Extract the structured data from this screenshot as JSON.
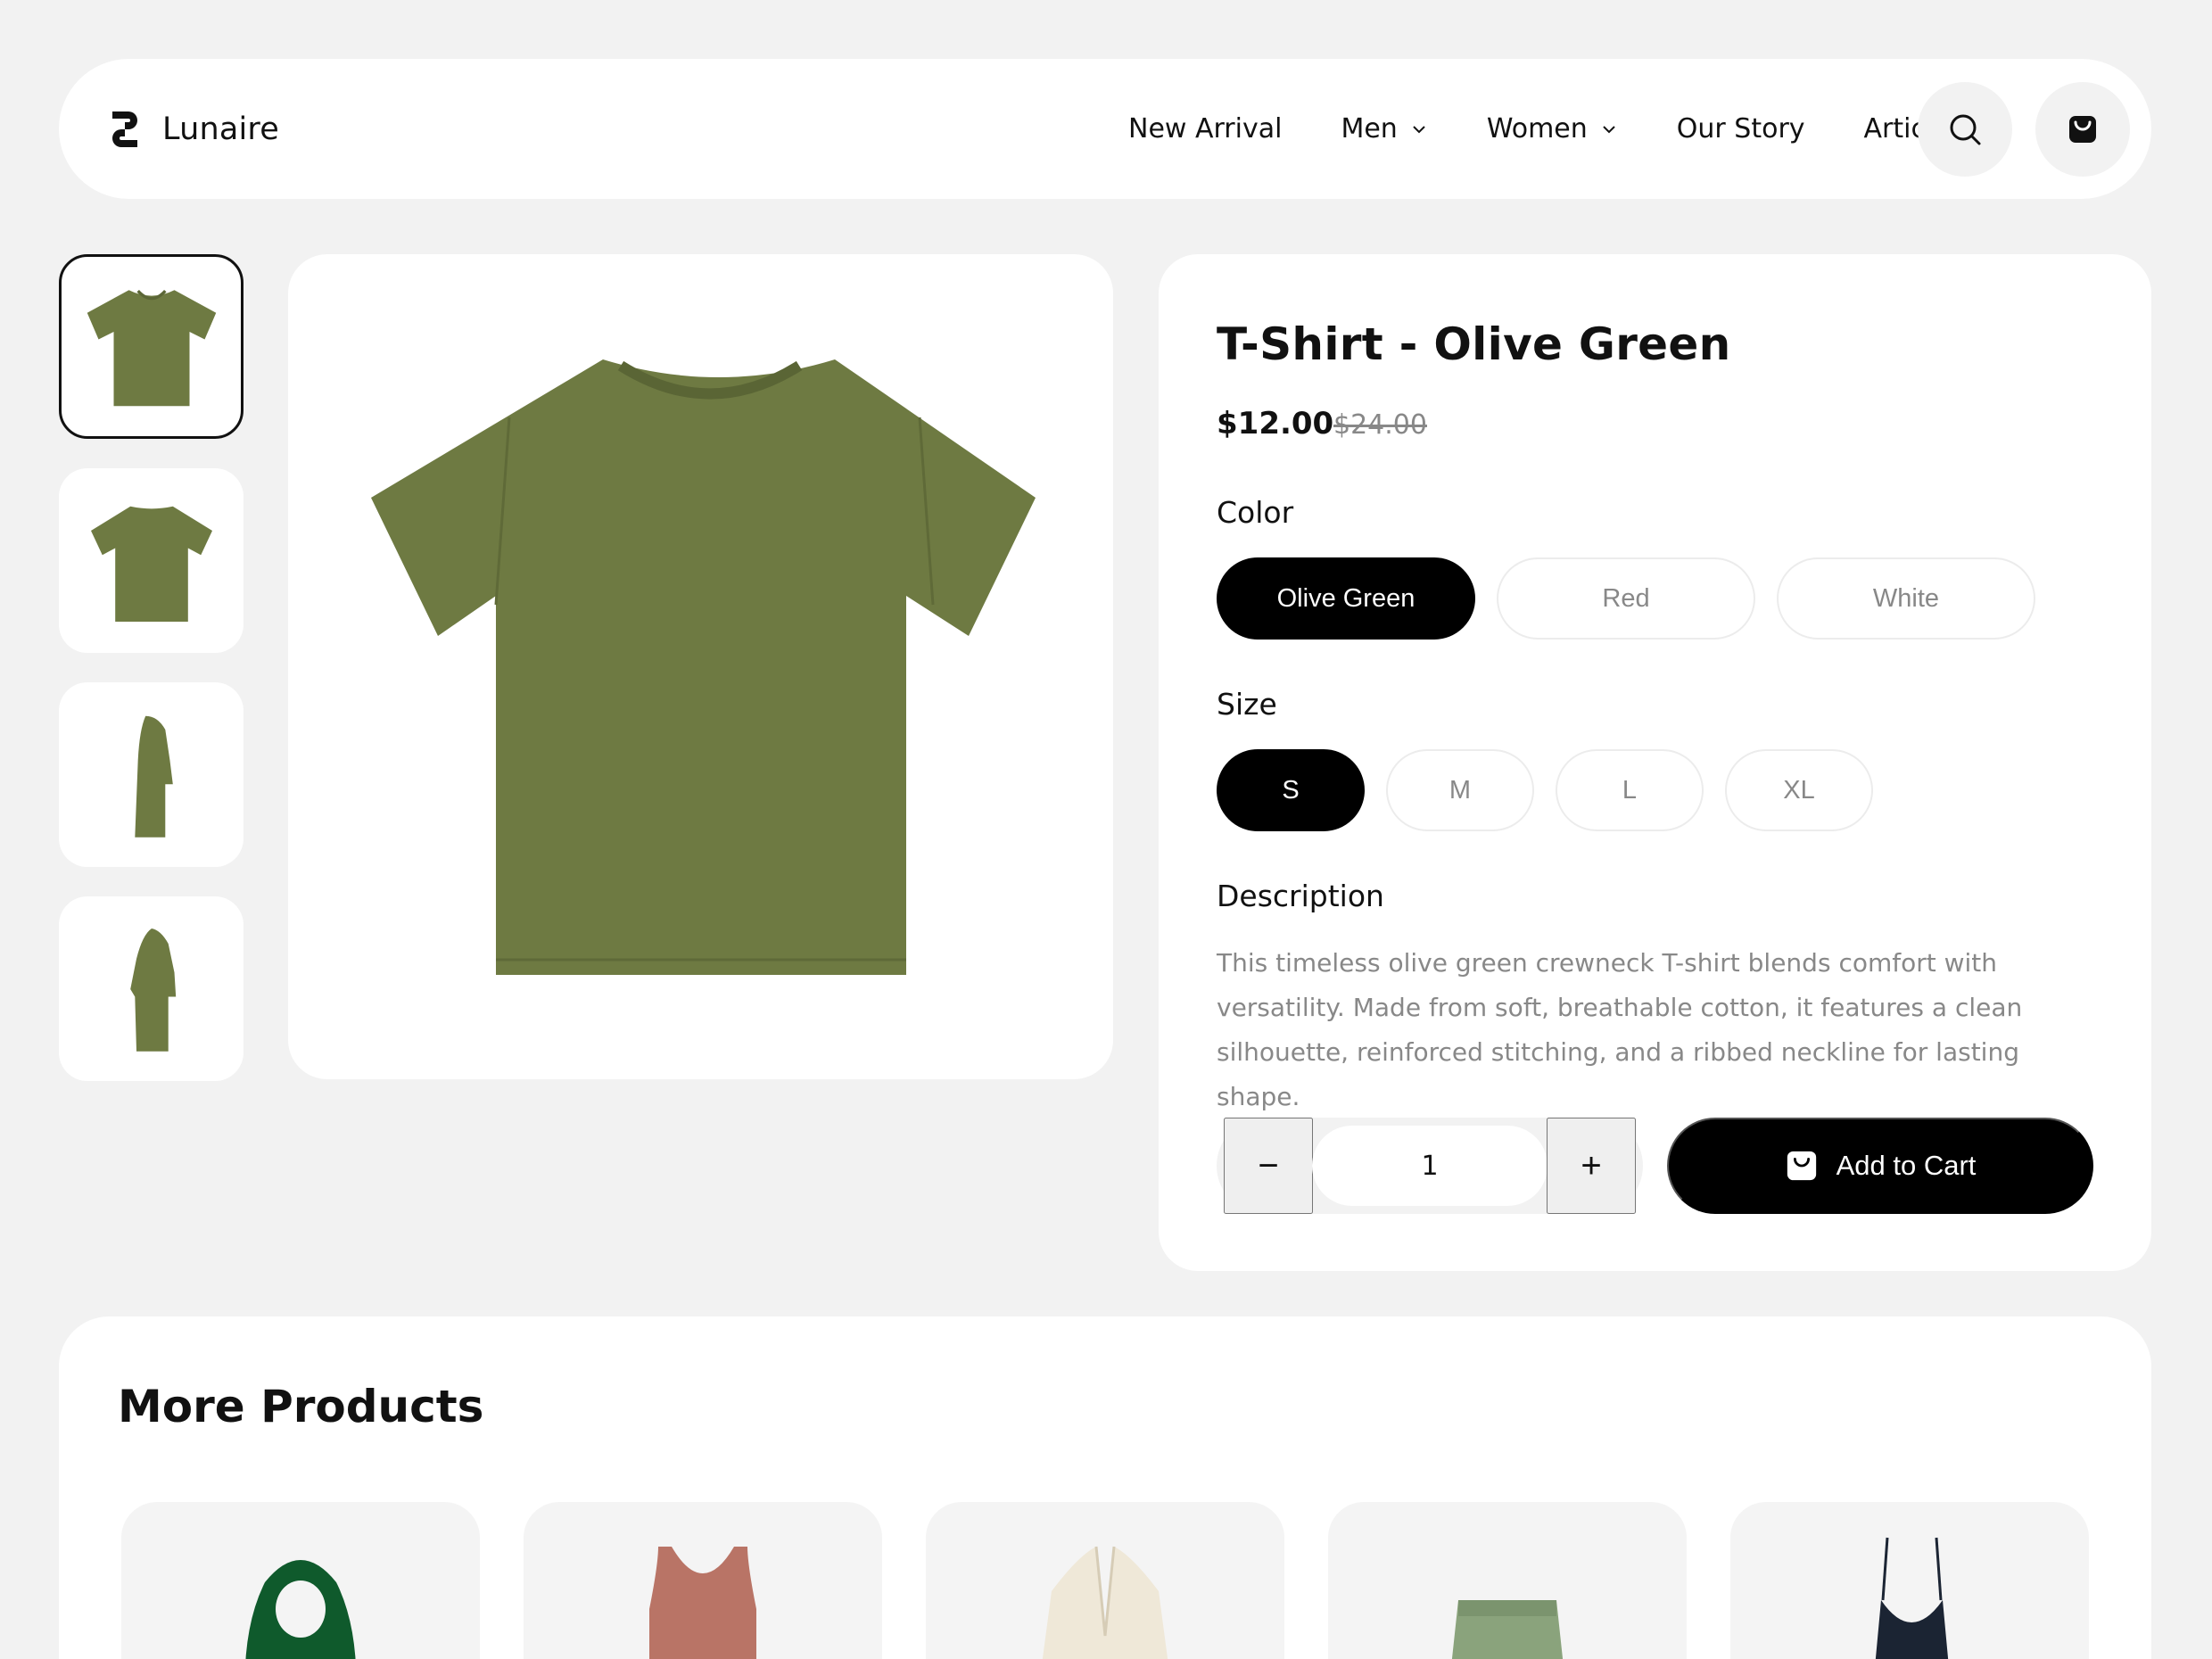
{
  "brand": {
    "name": "Lunaire"
  },
  "nav": {
    "items": [
      {
        "label": "New Arrival",
        "dropdown": false
      },
      {
        "label": "Men",
        "dropdown": true
      },
      {
        "label": "Women",
        "dropdown": true
      },
      {
        "label": "Our Story",
        "dropdown": false
      },
      {
        "label": "Articles",
        "dropdown": false
      }
    ],
    "icons": [
      "search-icon",
      "shopping-bag-icon"
    ]
  },
  "gallery": {
    "thumbnails": [
      "front-view",
      "back-view",
      "side-view-left",
      "side-view-right"
    ],
    "selected_index": 0
  },
  "product": {
    "title": "T-Shirt - Olive Green",
    "price": "$12.00",
    "old_price": "$24.00",
    "color_label": "Color",
    "colors": [
      "Olive Green",
      "Red",
      "White"
    ],
    "selected_color": "Olive Green",
    "size_label": "Size",
    "sizes": [
      "S",
      "M",
      "L",
      "XL"
    ],
    "selected_size": "S",
    "description_label": "Description",
    "description": "This timeless olive green crewneck T-shirt blends comfort with versatility. Made from soft, breathable cotton, it features a clean silhouette, reinforced stitching, and a ribbed neckline for lasting shape.",
    "quantity": "1",
    "minus_symbol": "−",
    "plus_symbol": "+",
    "add_to_cart_label": "Add to Cart"
  },
  "more_products": {
    "title": "More Products",
    "items": [
      "green-scarf",
      "rust-tank-top",
      "cream-blazer",
      "sage-shorts",
      "navy-slip-dress"
    ]
  },
  "colors": {
    "accent": "#000000",
    "olive": "#6e7a42",
    "background": "#f2f2f2",
    "muted_text": "#888888"
  }
}
